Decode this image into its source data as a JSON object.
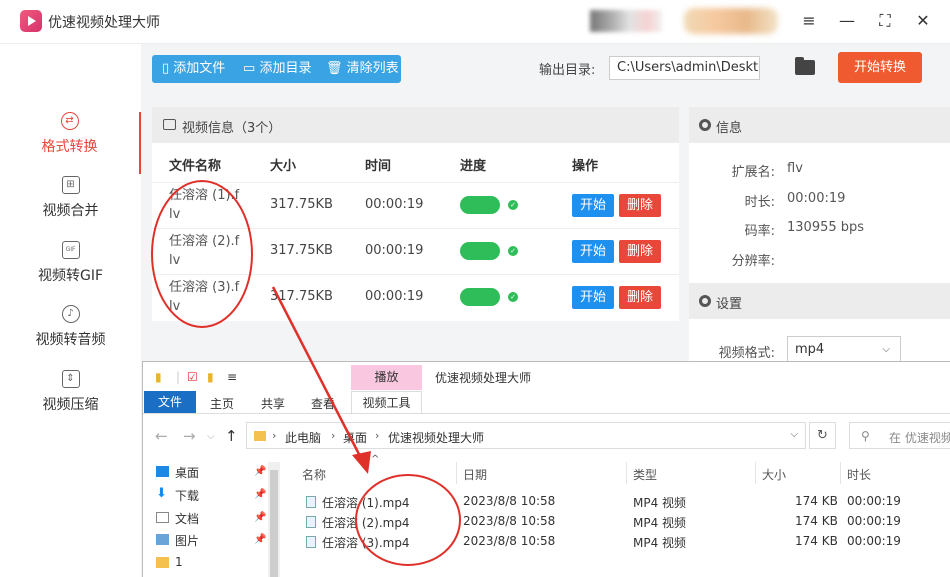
{
  "app": {
    "title": "优速视频处理大师",
    "window_controls": [
      "≡",
      "—",
      "⛶",
      "✕"
    ]
  },
  "sidebar": {
    "items": [
      {
        "label": "格式转换",
        "icon": "format-convert-icon",
        "active": true
      },
      {
        "label": "视频合并",
        "icon": "video-merge-icon"
      },
      {
        "label": "视频转GIF",
        "icon": "gif-icon"
      },
      {
        "label": "视频转音频",
        "icon": "audio-icon"
      },
      {
        "label": "视频压缩",
        "icon": "compress-icon"
      }
    ]
  },
  "toolbar": {
    "add_file": "添加文件",
    "add_dir": "添加目录",
    "clear_list": "清除列表",
    "output_label": "输出目录:",
    "output_path": "C:\\Users\\admin\\Deskto",
    "start_all": "开始转换"
  },
  "file_panel": {
    "header": "视频信息（3个）",
    "columns": [
      "文件名称",
      "大小",
      "时间",
      "进度",
      "操作"
    ],
    "rows": [
      {
        "name": "任溶溶 (1).flv",
        "size": "317.75KB",
        "time": "00:00:19",
        "progress": 1.0
      },
      {
        "name": "任溶溶 (2).flv",
        "size": "317.75KB",
        "time": "00:00:19",
        "progress": 1.0
      },
      {
        "name": "任溶溶 (3).flv",
        "size": "317.75KB",
        "time": "00:00:19",
        "progress": 1.0
      }
    ],
    "start_label": "开始",
    "delete_label": "删除",
    "progress_color": "#2ebd59"
  },
  "info": {
    "header": "信息",
    "ext_label": "扩展名:",
    "ext_value": "flv",
    "duration_label": "时长:",
    "duration_value": "00:00:19",
    "bitrate_label": "码率:",
    "bitrate_value": "130955 bps",
    "resolution_label": "分辨率:",
    "settings_header": "设置",
    "format_label": "视频格式:",
    "format_value": "mp4"
  },
  "explorer": {
    "context_tab": "播放",
    "title": "优速视频处理大师",
    "tabs": {
      "file": "文件",
      "home": "主页",
      "share": "共享",
      "view": "查看",
      "video_tools": "视频工具"
    },
    "path": [
      "此电脑",
      "桌面",
      "优速视频处理大师"
    ],
    "search_placeholder": "在 优速视频",
    "tree": [
      {
        "label": "桌面",
        "icon": "desktop-icon"
      },
      {
        "label": "下载",
        "icon": "download-icon"
      },
      {
        "label": "文档",
        "icon": "documents-icon"
      },
      {
        "label": "图片",
        "icon": "pictures-icon"
      },
      {
        "label": "1",
        "icon": "folder-icon"
      }
    ],
    "columns": [
      "名称",
      "日期",
      "类型",
      "大小",
      "时长"
    ],
    "files": [
      {
        "name": "任溶溶 (1).mp4",
        "date": "2023/8/8 10:58",
        "type": "MP4 视频",
        "size": "174 KB",
        "duration": "00:00:19"
      },
      {
        "name": "任溶溶 (2).mp4",
        "date": "2023/8/8 10:58",
        "type": "MP4 视频",
        "size": "174 KB",
        "duration": "00:00:19"
      },
      {
        "name": "任溶溶 (3).mp4",
        "date": "2023/8/8 10:58",
        "type": "MP4 视频",
        "size": "174 KB",
        "duration": "00:00:19"
      }
    ]
  },
  "colors": {
    "accent": "#e8473a",
    "toolbar": "#3aa3e3",
    "start_button": "#1e90f0",
    "annotation": "#e0302a"
  }
}
